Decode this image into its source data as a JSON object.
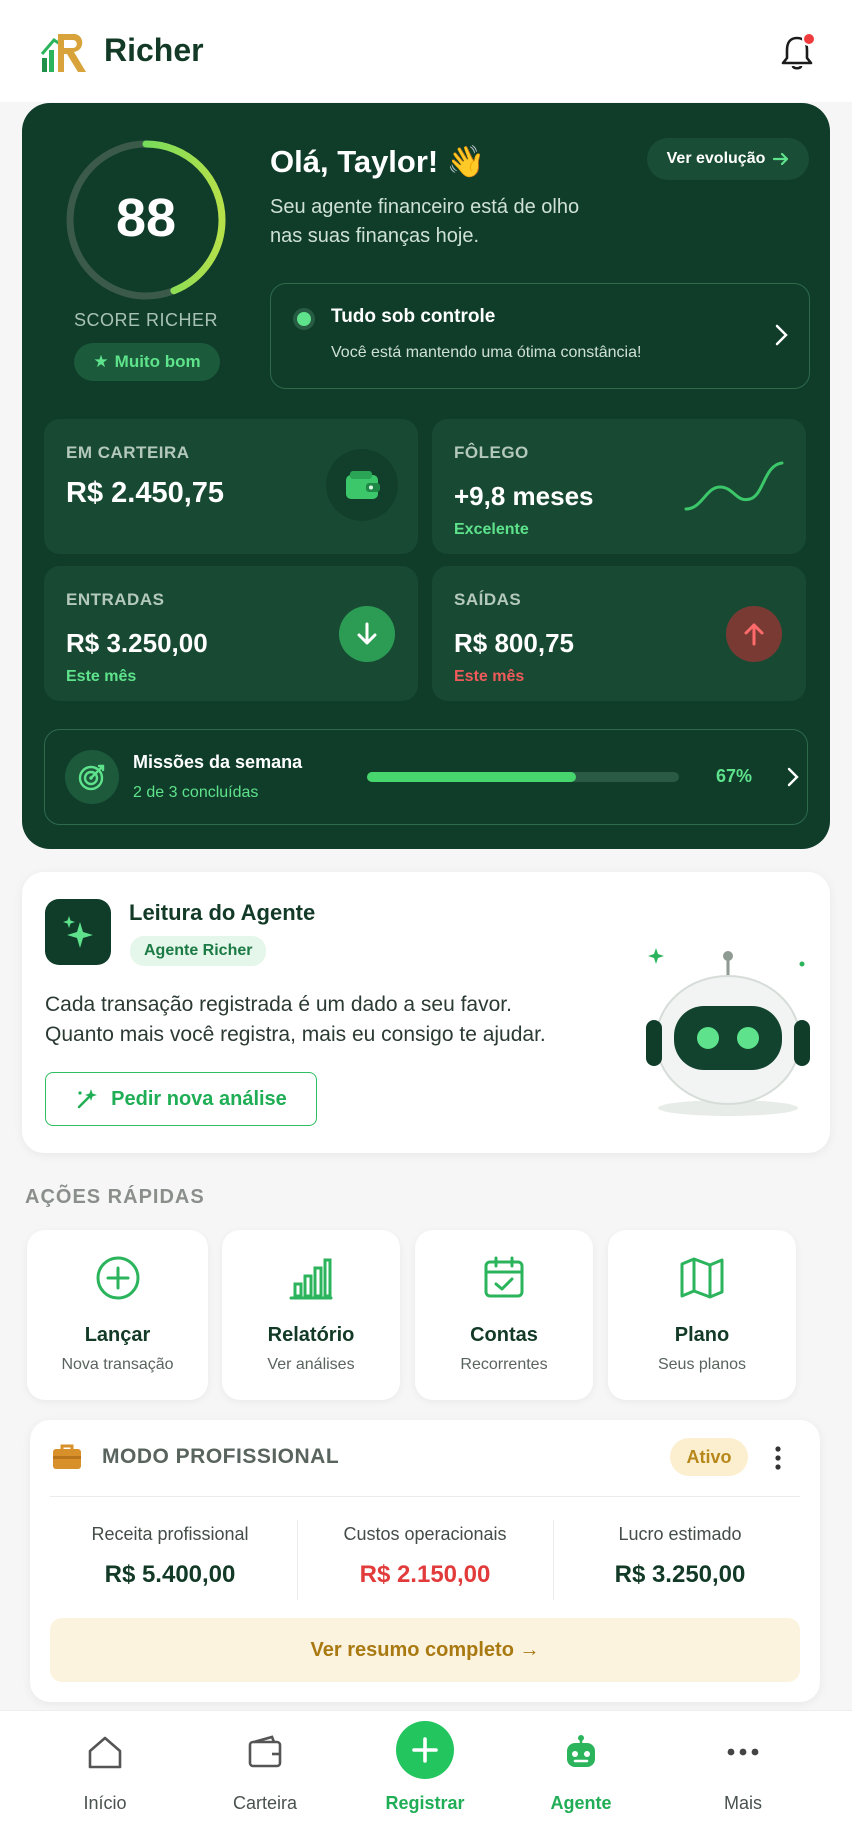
{
  "app": {
    "name": "Richer"
  },
  "hero": {
    "score": "88",
    "score_label": "SCORE RICHER",
    "score_progress": 0.44,
    "score_badge": "Muito bom",
    "greeting": "Olá, Taylor! 👋",
    "greeting_sub": "Seu agente financeiro está de olho nas suas finanças hoje.",
    "evolution_button": "Ver evolução",
    "status_title": "Tudo sob controle",
    "status_sub": "Você está mantendo uma ótima constância!"
  },
  "tiles": {
    "wallet": {
      "label": "EM CARTEIRA",
      "value": "R$ 2.450,75",
      "icon": "wallet-icon"
    },
    "breath": {
      "label": "FÔLEGO",
      "value": "+9,8 meses",
      "note": "Excelente",
      "icon": "trend-line-icon"
    },
    "income": {
      "label": "ENTRADAS",
      "value": "R$ 3.250,00",
      "note": "Este mês",
      "icon": "arrow-down-icon"
    },
    "expenses": {
      "label": "SAÍDAS",
      "value": "R$ 800,75",
      "note": "Este mês",
      "icon": "arrow-up-icon"
    }
  },
  "missions": {
    "title": "Missões da semana",
    "subtitle": "2 de 3 concluídas",
    "progress": 0.67,
    "percent": "67%"
  },
  "agent": {
    "title": "Leitura do Agente",
    "chip": "Agente Richer",
    "text": "Cada transação registrada é um dado a seu favor. Quanto mais você registra, mais eu consigo te ajudar.",
    "button": "Pedir nova análise"
  },
  "quick_actions": {
    "title": "AÇÕES RÁPIDAS",
    "items": [
      {
        "label": "Lançar",
        "sub": "Nova transação",
        "icon": "plus-circle-icon"
      },
      {
        "label": "Relatório",
        "sub": "Ver análises",
        "icon": "bar-chart-icon"
      },
      {
        "label": "Contas",
        "sub": "Recorrentes",
        "icon": "calendar-check-icon"
      },
      {
        "label": "Plano",
        "sub": "Seus planos",
        "icon": "map-icon"
      }
    ]
  },
  "professional": {
    "title": "MODO PROFISSIONAL",
    "badge": "Ativo",
    "revenue_label": "Receita profissional",
    "revenue_value": "R$ 5.400,00",
    "costs_label": "Custos operacionais",
    "costs_value": "R$ 2.150,00",
    "profit_label": "Lucro estimado",
    "profit_value": "R$ 3.250,00",
    "summary_button": "Ver resumo completo →"
  },
  "nav": {
    "items": [
      {
        "label": "Início",
        "icon": "home-icon"
      },
      {
        "label": "Carteira",
        "icon": "wallet-icon"
      },
      {
        "label": "Registrar",
        "icon": "plus-icon"
      },
      {
        "label": "Agente",
        "icon": "robot-icon"
      },
      {
        "label": "Mais",
        "icon": "more-dots-icon"
      }
    ]
  },
  "colors": {
    "dark_green": "#0f3d2a",
    "accent_green": "#22c55e",
    "danger_red": "#e23b3b",
    "gold": "#b7871a"
  }
}
